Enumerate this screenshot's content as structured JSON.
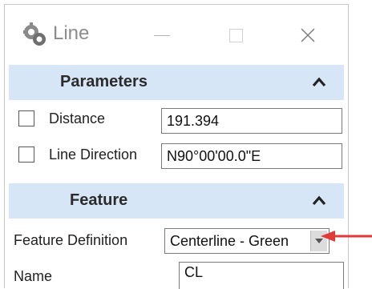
{
  "window": {
    "title": "Line",
    "app_icon": "settings-gears-icon",
    "buttons": {
      "minimize": "minimize-icon",
      "maximize": "maximize-icon",
      "close": "close-icon"
    }
  },
  "parameters": {
    "title": "Parameters",
    "distance": {
      "label": "Distance",
      "value": "191.394",
      "checked": false
    },
    "line_direction": {
      "label": "Line Direction",
      "value": "N90°00'00.0\"E",
      "checked": false
    }
  },
  "feature": {
    "title": "Feature",
    "feature_definition": {
      "label": "Feature Definition",
      "value": "Centerline - Green"
    },
    "name": {
      "label": "Name",
      "value": "CL"
    }
  },
  "annotation": {
    "arrow_color": "#e03a3a",
    "arrow_icon": "red-pointer-arrow"
  },
  "colors": {
    "section_header": "#d7e6f7",
    "title_text": "#8c8c8c"
  }
}
